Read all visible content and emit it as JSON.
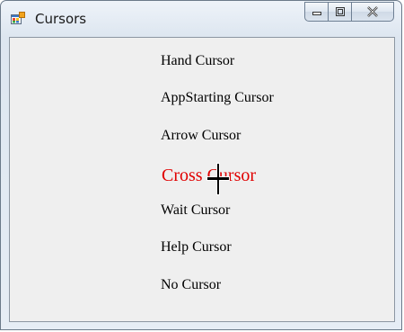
{
  "window": {
    "title": "Cursors",
    "icon": "windows-forms-app-icon"
  },
  "caption_buttons": {
    "minimize_icon": "minimize-icon",
    "maximize_icon": "maximize-icon",
    "close_icon": "close-icon"
  },
  "cursor_items": [
    {
      "label": "Hand Cursor",
      "active": false
    },
    {
      "label": "AppStarting Cursor",
      "active": false
    },
    {
      "label": "Arrow Cursor",
      "active": false
    },
    {
      "label": "Cross Cursor",
      "active": true
    },
    {
      "label": "Wait Cursor",
      "active": false
    },
    {
      "label": "Help Cursor",
      "active": false
    },
    {
      "label": "No Cursor",
      "active": false
    }
  ],
  "colors": {
    "active_label": "#e00000",
    "label": "#000000"
  },
  "pointer": {
    "icon": "crosshair-cursor-icon"
  }
}
